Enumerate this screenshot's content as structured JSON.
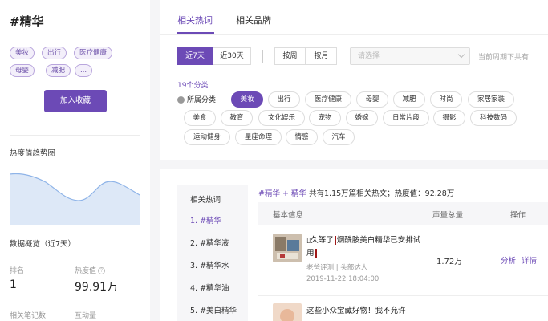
{
  "left": {
    "tag_title": "#精华",
    "tags": [
      "美妆",
      "出行",
      "医疗健康",
      "母婴",
      "减肥",
      "..."
    ],
    "fav_button": "加入收藏",
    "trend_title": "热度值趋势图",
    "overview_title": "数据概览（近7天）",
    "stats": {
      "rank_label": "排名",
      "rank_value": "1",
      "heat_label": "热度值",
      "heat_value": "99.91万",
      "notes_label": "相关笔记数",
      "interact_label": "互动量"
    }
  },
  "top": {
    "tabs": [
      "相关热词",
      "相关品牌"
    ],
    "range": [
      "近7天",
      "近30天"
    ],
    "period": [
      "按周",
      "按月"
    ],
    "select_placeholder": "请选择",
    "period_text": "当前周期下共有",
    "cat_count": "19个分类",
    "cat_label": "所属分类:",
    "categories": [
      "美妆",
      "出行",
      "医疗健康",
      "母婴",
      "减肥",
      "时尚",
      "家居家装",
      "美食",
      "教育",
      "文化娱乐",
      "宠物",
      "婚嫁",
      "日常片段",
      "摄影",
      "科技数码",
      "运动健身",
      "星座命理",
      "情感",
      "汽车"
    ]
  },
  "bottom": {
    "side_head": "相关热词",
    "side_items": [
      "1. #精华",
      "2. #精华液",
      "3. #精华水",
      "4. #精华油",
      "5. #美白精华"
    ],
    "summary_tags": "#精华 + 精华",
    "summary_prefix": "共有1.15万篇相关热文；热度值：",
    "summary_heat": "92.28万",
    "headers": [
      "基本信息",
      "声量总量",
      "操作"
    ],
    "article1": {
      "title_a": "▯久等了",
      "title_b": "烟酰胺美白精华已安排试用",
      "author": "老爸评测 | 头部达人",
      "date": "2019-11-22 18:04:00",
      "volume": "1.72万",
      "act1": "分析",
      "act2": "详情"
    },
    "article2": {
      "title": "这些小众宝藏好物！我不允许"
    }
  },
  "colors": {
    "accent": "#6c4ab6"
  }
}
